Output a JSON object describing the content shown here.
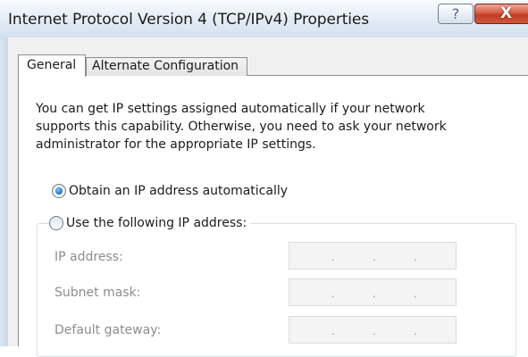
{
  "window": {
    "title": "Internet Protocol Version 4 (TCP/IPv4) Properties",
    "help_glyph": "?",
    "close_glyph": "X"
  },
  "tabs": [
    {
      "label": "General",
      "selected": true
    },
    {
      "label": "Alternate Configuration",
      "selected": false
    }
  ],
  "general": {
    "intro_lines": [
      "You can get IP settings assigned automatically if your network",
      "supports this capability. Otherwise, you need to ask your network",
      "administrator for the appropriate IP settings."
    ],
    "auto_ip_label": "Obtain an IP address automatically",
    "manual_ip_label": "Use the following IP address:",
    "selected_option": "auto",
    "fields": {
      "ip_address_label": "IP address:",
      "subnet_mask_label": "Subnet mask:",
      "default_gateway_label": "Default gateway:",
      "octet_separator": "."
    }
  },
  "colors": {
    "accent_radio": "#1f6fb8",
    "close_button": "#c23b24",
    "disabled_text": "#8d8d8d"
  },
  "icons": [
    "help-icon",
    "close-icon",
    "radio-checked-icon",
    "radio-unchecked-icon"
  ]
}
